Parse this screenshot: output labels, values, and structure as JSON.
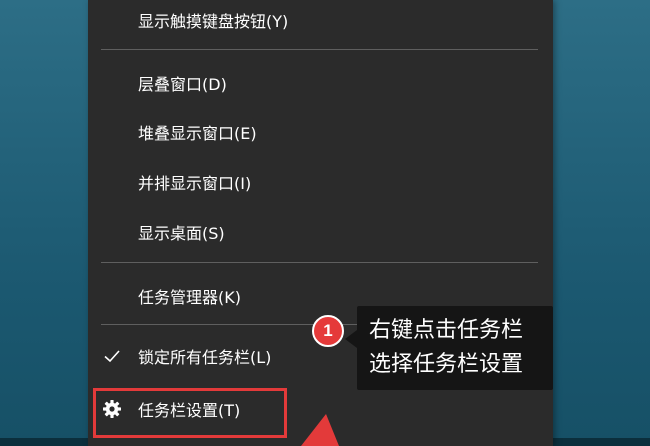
{
  "menu": {
    "items": [
      {
        "label": "显示触摸键盘按钮(Y)"
      },
      {
        "label": "层叠窗口(D)"
      },
      {
        "label": "堆叠显示窗口(E)"
      },
      {
        "label": "并排显示窗口(I)"
      },
      {
        "label": "显示桌面(S)"
      },
      {
        "label": "任务管理器(K)"
      },
      {
        "label": "锁定所有任务栏(L)",
        "checked": true,
        "icon": "check-icon"
      },
      {
        "label": "任务栏设置(T)",
        "icon": "gear-icon"
      }
    ]
  },
  "annotation": {
    "step": "1",
    "line1": "右键点击任务栏",
    "line2": "选择任务栏设置",
    "accent_color": "#e33a3a"
  }
}
